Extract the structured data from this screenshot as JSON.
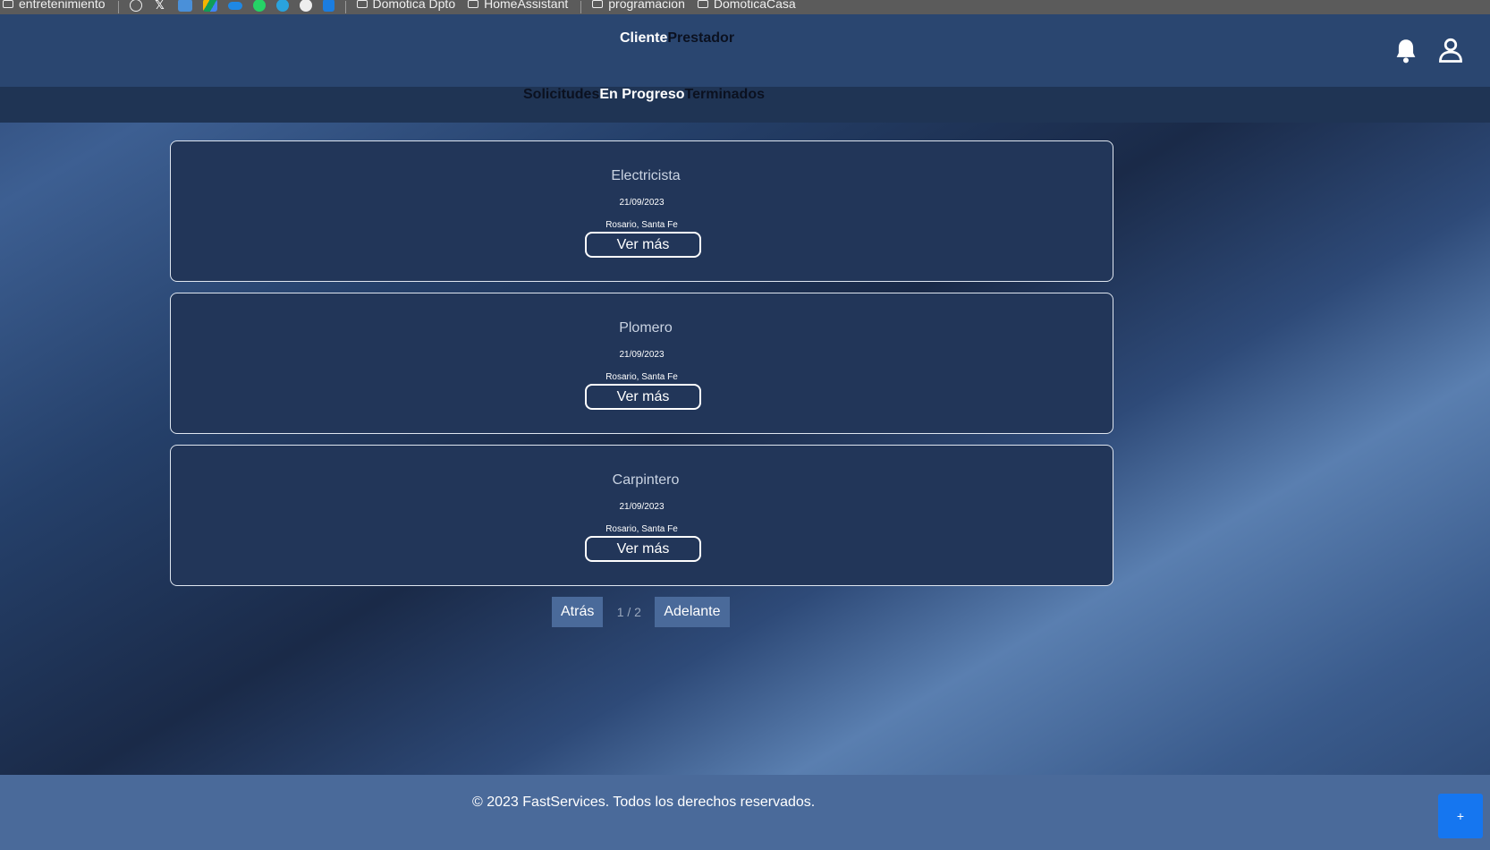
{
  "bookmarks": {
    "folder1": "entretenimiento",
    "folder2": "Domotica Dpto",
    "folder3": "HomeAssistant",
    "folder4": "programacion",
    "folder5": "DomoticaCasa",
    "favicons": [
      "wordpress-icon",
      "x-icon",
      "office-icon",
      "drive-icon",
      "onedrive-icon",
      "whatsapp-icon",
      "telegram-icon",
      "github-icon",
      "trello-icon"
    ]
  },
  "header": {
    "role_cliente": "Cliente",
    "role_prestador": "Prestador"
  },
  "tabs": {
    "solicitudes": "Solicitudes",
    "en_progreso": "En Progreso",
    "terminados": "Terminados"
  },
  "cards": [
    {
      "title": "Electricista",
      "date": "21/09/2023",
      "location": "Rosario, Santa Fe",
      "button": "Ver más"
    },
    {
      "title": "Plomero",
      "date": "21/09/2023",
      "location": "Rosario, Santa Fe",
      "button": "Ver más"
    },
    {
      "title": "Carpintero",
      "date": "21/09/2023",
      "location": "Rosario, Santa Fe",
      "button": "Ver más"
    }
  ],
  "pagination": {
    "prev": "Atrás",
    "count": "1 / 2",
    "next": "Adelante"
  },
  "footer": {
    "text": "© 2023 FastServices. Todos los derechos reservados."
  },
  "fab": {
    "label": "+"
  },
  "colors": {
    "header": "#2a4670",
    "subnav": "#1f3454",
    "card": "#223659",
    "footer": "#4a6a9a",
    "fab": "#1576f0"
  }
}
